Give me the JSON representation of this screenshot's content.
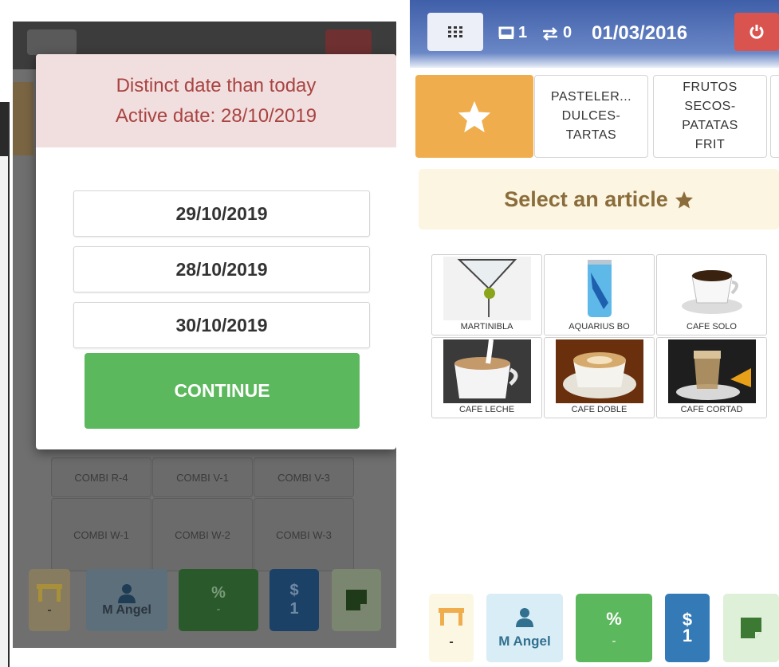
{
  "left_screen": {
    "modal": {
      "title_line1": "Distinct date than today",
      "title_line2": "Active date: 28/10/2019",
      "date_options": [
        "29/10/2019",
        "28/10/2019",
        "30/10/2019"
      ],
      "continue_label": "CONTINUE"
    },
    "background_grid": [
      "COMBI R-4",
      "COMBI V-1",
      "COMBI V-3",
      "COMBI W-1",
      "COMBI W-2",
      "COMBI W-3"
    ],
    "footer": {
      "table_value": "-",
      "user_name": "M Angel",
      "discount_label": "%",
      "discount_value": "-",
      "cash_label": "$",
      "cash_value": "1"
    }
  },
  "right_screen": {
    "header": {
      "tickets_count": "1",
      "transfers_count": "0",
      "date": "01/03/2016"
    },
    "categories": [
      {
        "label": "PASTELER...\nDULCES-\nTARTAS"
      },
      {
        "label": "FRUTOS\nSECOS-\nPATATAS\nFRIT"
      }
    ],
    "banner_text": "Select an article",
    "articles": [
      {
        "label": "MARTINIBLA"
      },
      {
        "label": "AQUARIUS BO"
      },
      {
        "label": "CAFE SOLO"
      },
      {
        "label": "CAFE LECHE"
      },
      {
        "label": "CAFE DOBLE"
      },
      {
        "label": "CAFE CORTAD"
      }
    ],
    "footer": {
      "table_value": "-",
      "user_name": "M Angel",
      "discount_label": "%",
      "discount_value": "-",
      "cash_label": "$",
      "cash_value": "1"
    }
  },
  "colors": {
    "header_blue": "#3f5fa9",
    "favorite_orange": "#f0ad4e",
    "success_green": "#5cb85c",
    "danger_red": "#d9534f",
    "primary_blue": "#337ab7",
    "warning_text": "#8a6d3b",
    "alert_red_text": "#a94442"
  },
  "icons": [
    "grid-menu-icon",
    "ticket-icon",
    "transfer-icon",
    "power-icon",
    "star-icon",
    "table-icon",
    "user-icon",
    "note-icon"
  ]
}
